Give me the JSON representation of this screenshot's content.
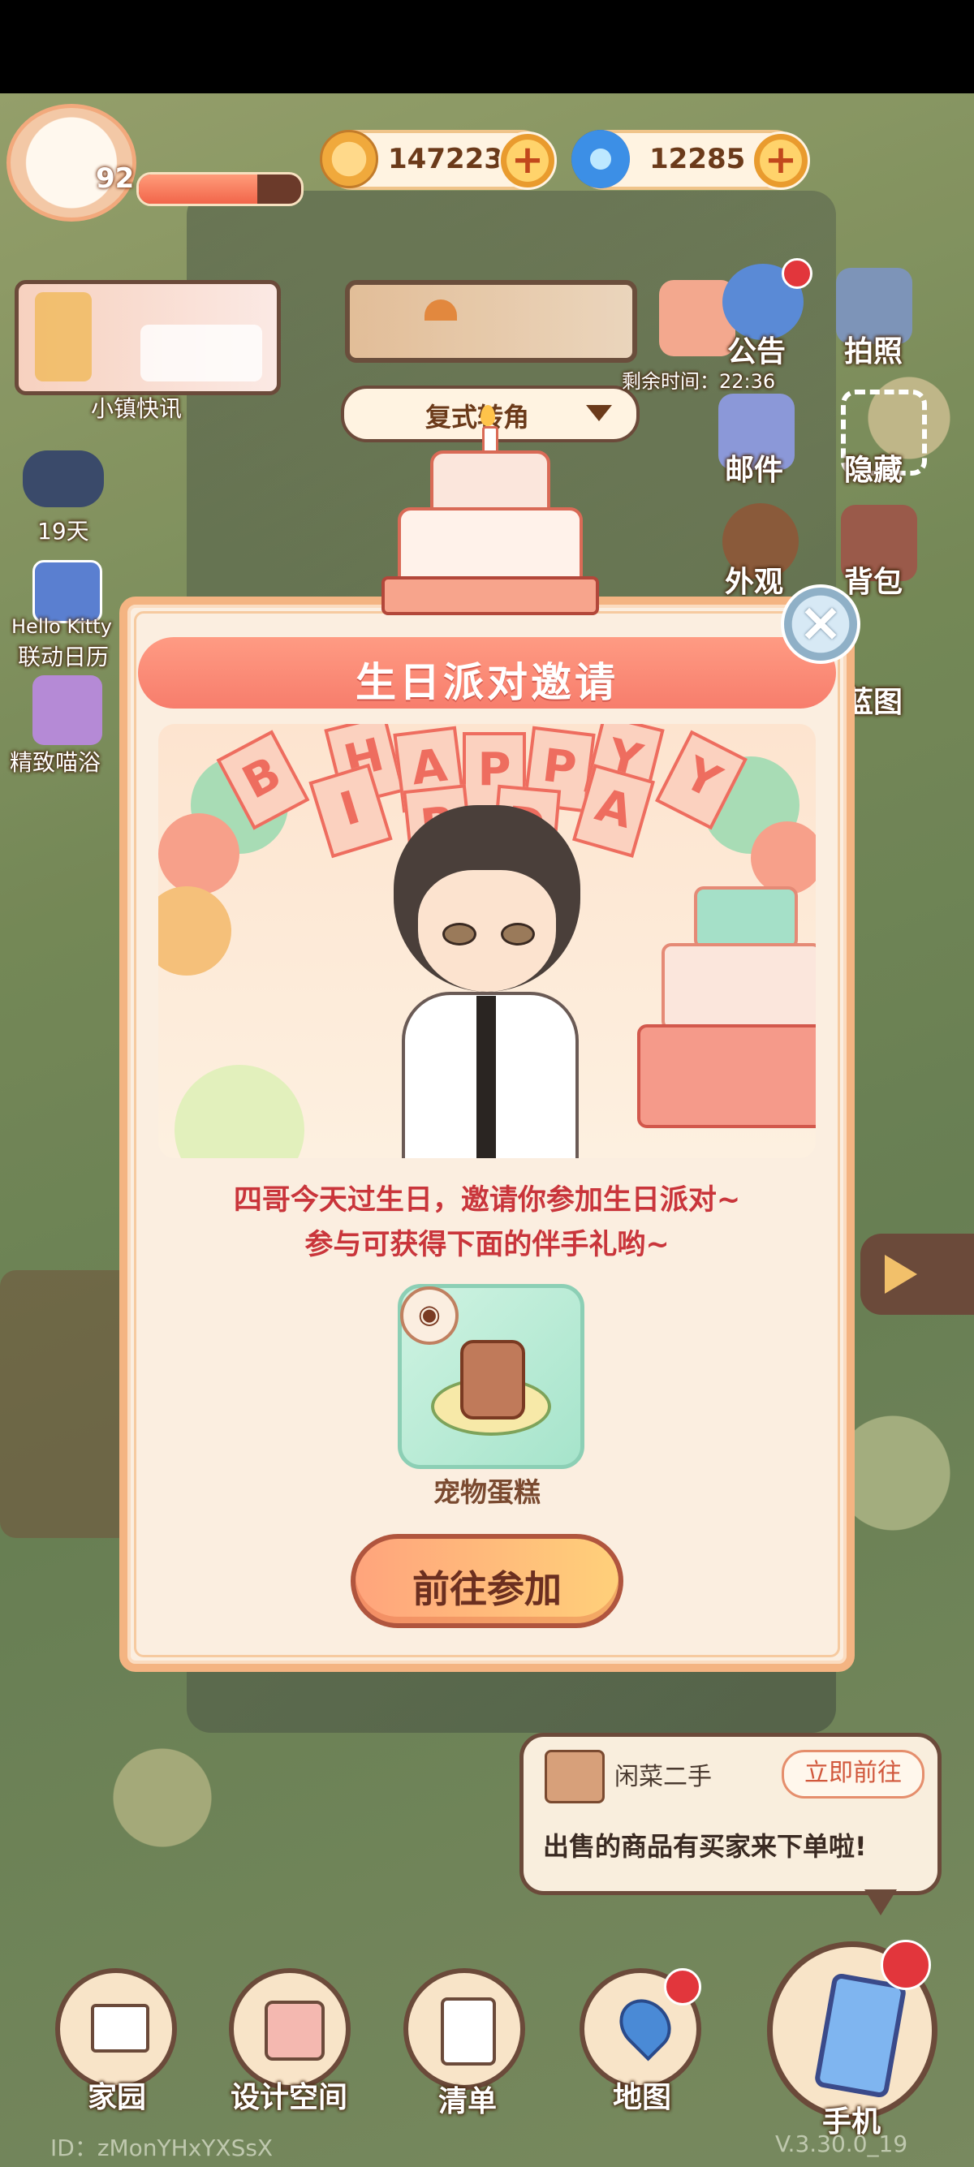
{
  "hud": {
    "level": "92",
    "xp_fraction": 0.73,
    "gold": "1472238",
    "gems": "12285",
    "plus": "+"
  },
  "left_side": {
    "news": "小镇快讯",
    "event_days": "19天",
    "calendar_line1": "Hello Kitty",
    "calendar_line2": "联动日历",
    "bath": "精致喵浴"
  },
  "selector": {
    "room": "复式转角"
  },
  "right_side": {
    "timer": "剩余时间：22:36",
    "notice": "公告",
    "photo": "拍照",
    "mail": "邮件",
    "hide": "隐藏",
    "outfit": "外观",
    "bag": "背包",
    "blueprint": "蓝图"
  },
  "modal": {
    "title": "生日派对邀请",
    "banner_top": [
      "H",
      "A",
      "P",
      "P",
      "Y"
    ],
    "banner_bottom": [
      "B",
      "I",
      "R",
      "D",
      "A",
      "Y"
    ],
    "line1": "四哥今天过生日，邀请你参加生日派对~",
    "line2": "参与可获得下面的伴手礼哟~",
    "reward_name": "宠物蛋糕",
    "go_button": "前往参加",
    "close": "×"
  },
  "notification": {
    "app_name": "闲菜二手",
    "go_label": "立即前往",
    "message": "出售的商品有买家来下单啦!"
  },
  "bottom_nav": {
    "home": "家园",
    "design": "设计空间",
    "list": "清单",
    "map": "地图",
    "phone": "手机"
  },
  "footer": {
    "id": "ID：zMonYHxYXSsX",
    "version": "V.3.30.0_19"
  },
  "colors": {
    "modal_bg": "#fbeee0",
    "title_band": "#f77d6c",
    "invite_text": "#c9353b",
    "badge_red": "#e2363c"
  }
}
